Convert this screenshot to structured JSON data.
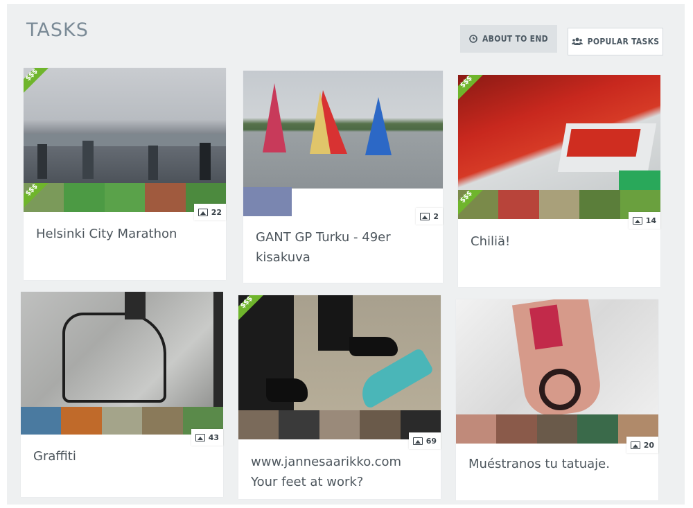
{
  "header": {
    "title": "TASKS",
    "about_to_end_label": "ABOUT TO END",
    "popular_tasks_label": "POPULAR TASKS",
    "about_to_end_icon": "clock-icon",
    "popular_tasks_icon": "users-icon"
  },
  "badge_label": "$$$",
  "tasks": [
    {
      "title": "Helsinki City Marathon",
      "count": "22",
      "paid": true
    },
    {
      "title": "GANT GP Turku - 49er kisakuva",
      "count": "2",
      "paid": false
    },
    {
      "title": "Chiliä!",
      "count": "14",
      "paid": true
    },
    {
      "title": "Graffiti",
      "count": "43",
      "paid": false
    },
    {
      "title": "www.jannesaarikko.com Your feet at work?",
      "count": "69",
      "paid": true
    },
    {
      "title": "Muéstranos tu tatuaje.",
      "count": "20",
      "paid": false
    }
  ],
  "colors": {
    "badge_green": "#6fb52c",
    "board_background": "#eef0f1",
    "title_text": "#4d565d"
  }
}
